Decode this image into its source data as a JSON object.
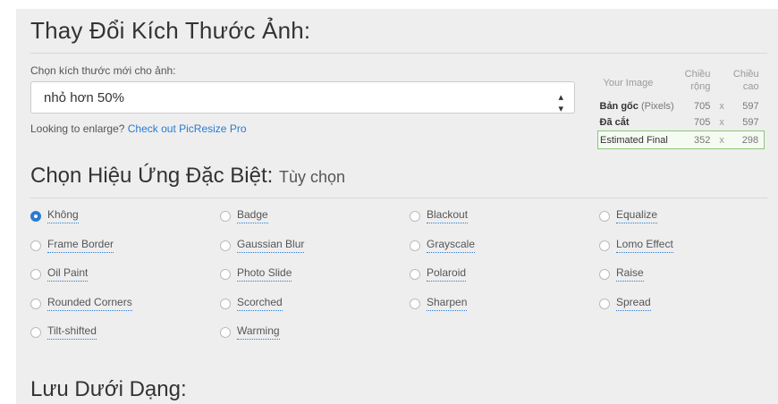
{
  "resize": {
    "heading": "Thay Đổi Kích Thước Ảnh:",
    "choose_label": "Chọn kích thước mới cho ảnh:",
    "selected_size": "nhỏ hơn 50%",
    "enlarge_text": "Looking to enlarge?",
    "enlarge_link": "Check out PicResize Pro"
  },
  "size_table": {
    "col_image": "Your Image",
    "col_width_1": "Chiều",
    "col_width_2": "rộng",
    "col_height_1": "Chiều",
    "col_height_2": "cao",
    "rows": [
      {
        "name": "Bản gốc",
        "sub": "(Pixels)",
        "width": "705",
        "x": "x",
        "height": "597"
      },
      {
        "name": "Đã cắt",
        "sub": "",
        "width": "705",
        "x": "x",
        "height": "597"
      },
      {
        "name": "Estimated Final",
        "sub": "",
        "width": "352",
        "x": "x",
        "height": "298"
      }
    ]
  },
  "effects": {
    "heading": "Chọn Hiệu Ứng Đặc Biệt:",
    "heading_optional": "Tùy chọn",
    "selected": "Không",
    "items": [
      "Không",
      "Badge",
      "Blackout",
      "Equalize",
      "Frame Border",
      "Gaussian Blur",
      "Grayscale",
      "Lomo Effect",
      "Oil Paint",
      "Photo Slide",
      "Polaroid",
      "Raise",
      "Rounded Corners",
      "Scorched",
      "Sharpen",
      "Spread",
      "Tilt-shifted",
      "Warming"
    ]
  },
  "save": {
    "heading": "Lưu Dưới Dạng:"
  },
  "colors": {
    "accent": "#2a7bd0",
    "panel_bg": "#eeeeee",
    "final_border": "#8cc67a"
  }
}
